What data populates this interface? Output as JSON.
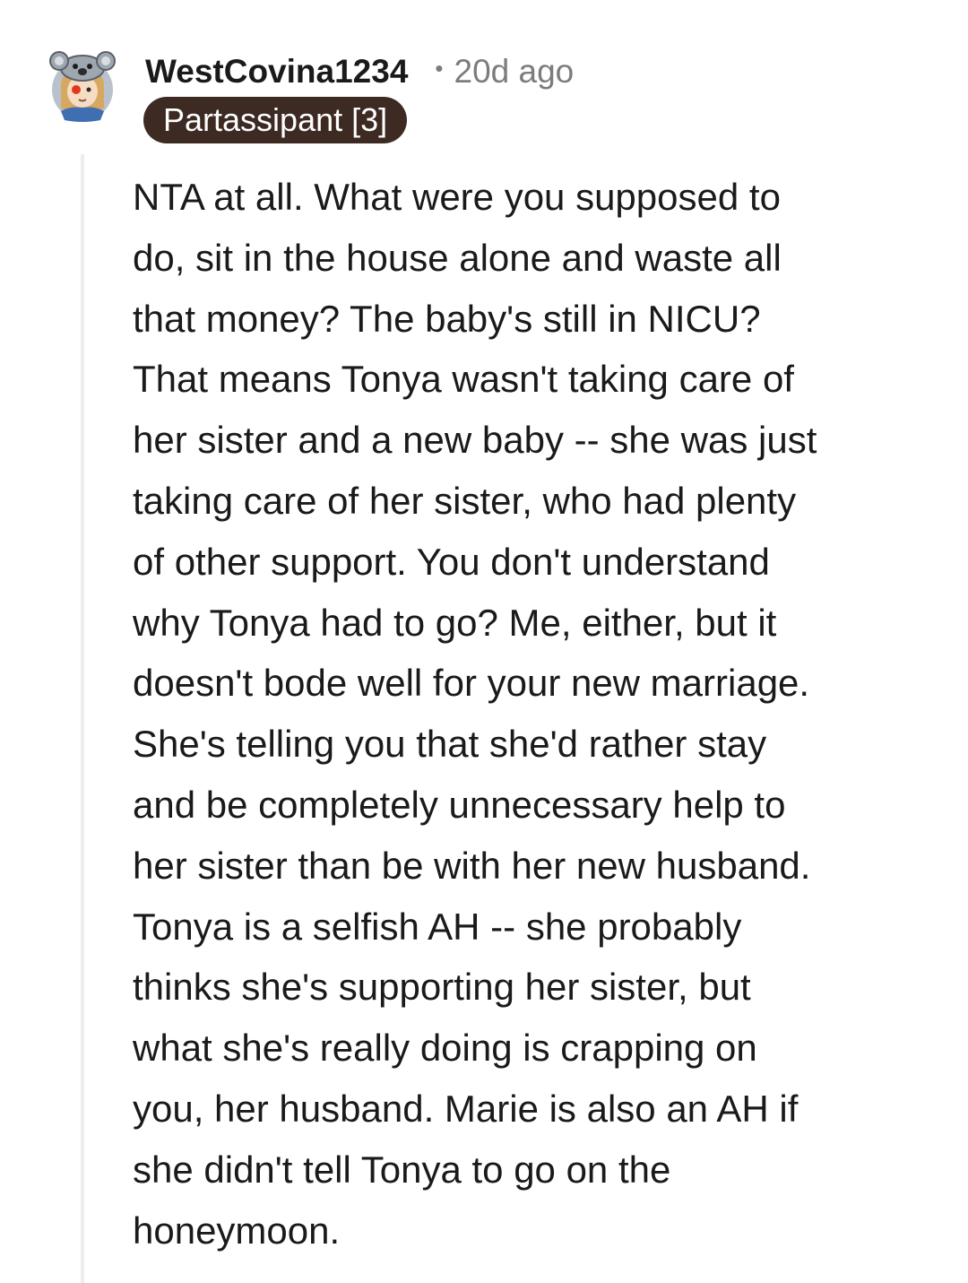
{
  "comment": {
    "author": "WestCovina1234",
    "separator": "•",
    "time_ago": "20d ago",
    "flair": "Partassipant [3]",
    "avatar_icon": "koala-hat-avatar-icon",
    "flair_color": "#3d2a22",
    "body_lines": [
      "NTA at all. What were you supposed to",
      "do, sit in the house alone and waste all",
      "that money? The baby's still in NICU?",
      "That means Tonya wasn't taking care of",
      "her sister and a new baby -- she was just",
      "taking care of her sister, who had plenty",
      "of other support. You don't understand",
      "why Tonya had to go? Me, either, but it",
      "doesn't bode well for your new marriage.",
      "She's telling you that she'd rather stay",
      "and be completely unnecessary help to",
      "her sister than be with her new husband.",
      "Tonya is a selfish AH -- she probably",
      "thinks she's supporting her sister, but",
      "what she's really doing is crapping on",
      "you, her husband. Marie is also an AH if",
      "she didn't tell Tonya to go on the",
      "honeymoon."
    ]
  }
}
